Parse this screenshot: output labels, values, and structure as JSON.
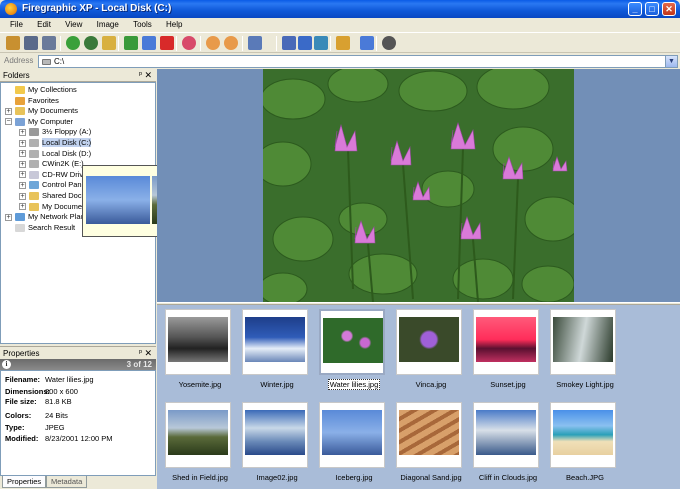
{
  "window": {
    "title": "Firegraphic XP - Local Disk (C:)",
    "min": "_",
    "max": "□",
    "close": "✕"
  },
  "menu": [
    "File",
    "Edit",
    "View",
    "Image",
    "Tools",
    "Help"
  ],
  "address": {
    "label": "Address",
    "value": "C:\\",
    "dropdown": "▼"
  },
  "folders": {
    "title": "Folders",
    "pin": "ᵖ",
    "close": "✕",
    "items": [
      {
        "label": "My Collections",
        "color": "#f2c94c"
      },
      {
        "label": "Favorites",
        "color": "#e8a23a"
      },
      {
        "label": "My Documents",
        "color": "#e8c35a"
      },
      {
        "label": "My Computer",
        "color": "#7ba2d6"
      },
      {
        "label": "3½ Floppy (A:)",
        "color": "#9a9a9a"
      },
      {
        "label": "Local Disk (C:)",
        "color": "#b0b0b0"
      },
      {
        "label": "Local Disk (D:)",
        "color": "#b0b0b0"
      },
      {
        "label": "CWin2K (E:)",
        "color": "#b0b0b0"
      },
      {
        "label": "CD-RW Drive",
        "color": "#c8c8d8"
      },
      {
        "label": "Control Pane",
        "color": "#6ea6d8"
      },
      {
        "label": "Shared Docu",
        "color": "#e8c35a"
      },
      {
        "label": "My Documen",
        "color": "#e8c35a"
      },
      {
        "label": "My Network Plac",
        "color": "#5f9bd8"
      },
      {
        "label": "Search Result",
        "color": "#d8d8d8"
      }
    ]
  },
  "properties": {
    "title": "Properties",
    "pin": "ᵖ",
    "close": "✕",
    "info_icon": "i",
    "count": "3 of 12",
    "rows": [
      {
        "key": "Filename:",
        "value": "Water lilies.jpg"
      },
      {
        "key": "Dimensions:",
        "value": "800 x 600"
      },
      {
        "key": "File size:",
        "value": "81.8 KB"
      },
      {
        "key": "Colors:",
        "value": "24 Bits"
      },
      {
        "key": "Type:",
        "value": "JPEG"
      },
      {
        "key": "Modified:",
        "value": "8/23/2001 12:00 PM"
      }
    ],
    "tabs": [
      "Properties",
      "Metadata"
    ]
  },
  "thumbnails": [
    {
      "caption": "Yosemite.jpg",
      "bg": "linear-gradient(#9a9a9a,#555 45%,#222 70%,#777)"
    },
    {
      "caption": "Winter.jpg",
      "bg": "linear-gradient(#1e3e8a,#2f5cb8 45%,#e6eef8 70%,#6a86b8)"
    },
    {
      "caption": "Water lilies.jpg",
      "bg": "radial-gradient(circle at 40% 40%,#d47ad8 0 10%,transparent 14%),radial-gradient(circle at 70% 55%,#c868d0 0 9%,transparent 13%),#2f6a2a"
    },
    {
      "caption": "Vinca.jpg",
      "bg": "radial-gradient(circle at 50% 50%,#a060d8 0 20%,transparent 26%),#3a4a2a"
    },
    {
      "caption": "Sunset.jpg",
      "bg": "linear-gradient(#ff5a7a,#ff2d5a 50%,#5a1030 70%,#c03060)"
    },
    {
      "caption": "Smokey Light.jpg",
      "bg": "linear-gradient(100deg,#3a4a3a,#cfd8d8 50%,#2a3a2a)"
    },
    {
      "caption": "Shed in Field.jpg",
      "bg": "linear-gradient(#7a9ac8,#b8c8d8 40%,#5a6a3a 60%,#2a3a1a)"
    },
    {
      "caption": "Image02.jpg",
      "bg": "linear-gradient(#3a6ab8,#c8d8e8 40%,#6a8ab8 70%,#2a4a8a)"
    },
    {
      "caption": "Iceberg.jpg",
      "bg": "linear-gradient(#5a8ad8,#8ab0e8 50%,#3a5a9a)"
    },
    {
      "caption": "Diagonal Sand.jpg",
      "bg": "repeating-linear-gradient(150deg,#d8a06a 0 6px,#a8683a 6px 10px)"
    },
    {
      "caption": "Cliff in Clouds.jpg",
      "bg": "linear-gradient(#4a7ac8,#d8e0e8 45%,#3a5a8a)"
    },
    {
      "caption": "Beach.JPG",
      "bg": "linear-gradient(#4a90e8,#8ac0f0 35%,#2aa0b8 55%,#f0e0b8 70%,#e8d0a0)"
    }
  ],
  "popup": [
    {
      "bg": "linear-gradient(#5a8ad8,#8ab0e8 50%,#3a5a9a)"
    },
    {
      "bg": "linear-gradient(#7a9ac8,#b8c8d8 40%,#5a6a3a 60%,#2a3a1a)"
    },
    {
      "bg": "linear-gradient(100deg,#3a4a3a,#cfd8d8 50%,#2a3a2a)"
    },
    {
      "bg": "linear-gradient(#ff5a7a,#ff2d5a 50%,#5a1030 70%,#c03060)"
    }
  ],
  "toolbar": [
    {
      "name": "properties-icon",
      "color": "#c89030"
    },
    {
      "name": "save-icon",
      "color": "#5a6a8a"
    },
    {
      "name": "print-icon",
      "color": "#6a7a9a"
    },
    {
      "name": "back-icon",
      "color": "#3aa03a"
    },
    {
      "name": "forward-icon",
      "color": "#3a7a3a"
    },
    {
      "name": "up-folder-icon",
      "color": "#d8b040"
    },
    {
      "name": "move-icon",
      "color": "#3a9a3a"
    },
    {
      "name": "copy-icon",
      "color": "#4a7ad8"
    },
    {
      "name": "delete-icon",
      "color": "#d82a2a"
    },
    {
      "name": "favorites-icon",
      "color": "#d84a6a"
    },
    {
      "name": "rotate-left-icon",
      "color": "#e89a4a"
    },
    {
      "name": "rotate-right-icon",
      "color": "#e89a4a"
    },
    {
      "name": "view-mode-icon",
      "color": "#5a7ab8"
    },
    {
      "name": "select-icon",
      "color": "#4a6ab8"
    },
    {
      "name": "fullscreen-icon",
      "color": "#3a6ac8"
    },
    {
      "name": "slideshow-icon",
      "color": "#3a8ab8"
    },
    {
      "name": "edit-icon",
      "color": "#d8a030"
    },
    {
      "name": "compare-icon",
      "color": "#4a7ad8"
    },
    {
      "name": "info-icon",
      "color": "#555555"
    }
  ]
}
